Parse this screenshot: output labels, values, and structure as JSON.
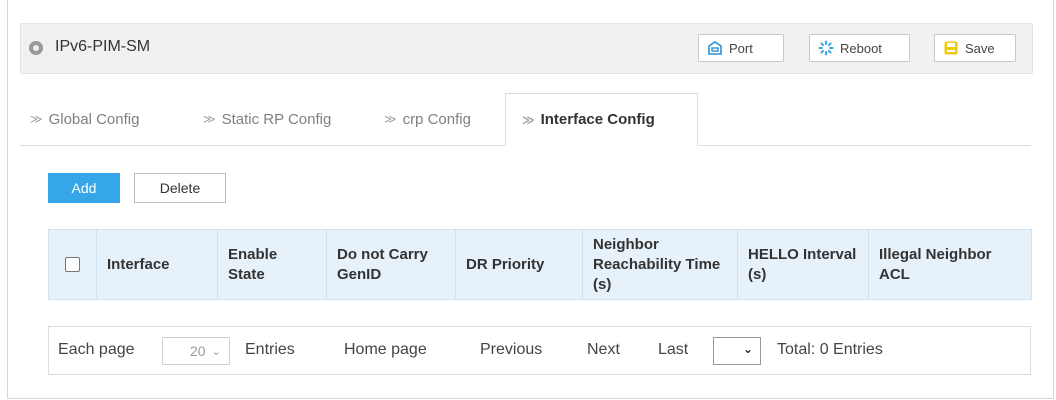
{
  "window": {
    "title": "IPv6-PIM-SM"
  },
  "toolbar": {
    "port_label": "Port",
    "reboot_label": "Reboot",
    "save_label": "Save"
  },
  "tabs": [
    {
      "label": "Global Config",
      "active": false
    },
    {
      "label": "Static RP Config",
      "active": false
    },
    {
      "label": "crp Config",
      "active": false
    },
    {
      "label": "Interface Config",
      "active": true
    }
  ],
  "actions": {
    "add_label": "Add",
    "delete_label": "Delete"
  },
  "table": {
    "columns": [
      "Interface",
      "Enable State",
      "Do not Carry GenID",
      "DR Priority",
      "Neighbor Reachability Time (s)",
      "HELLO Interval (s)",
      "Illegal Neighbor ACL"
    ],
    "rows": []
  },
  "pager": {
    "each_page_label": "Each page",
    "page_size": "20",
    "entries_label": "Entries",
    "home_label": "Home page",
    "previous_label": "Previous",
    "next_label": "Next",
    "last_label": "Last",
    "page_select": "",
    "total_label": "Total: 0 Entries"
  },
  "colors": {
    "accent": "#35a7e8",
    "header_bg": "#e6f1fa",
    "save_icon": "#f2c811",
    "port_icon": "#2a8fd6",
    "reboot_icon": "#35a7e8"
  }
}
